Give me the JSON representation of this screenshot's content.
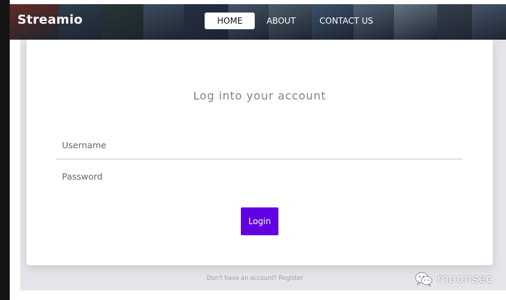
{
  "header": {
    "brand": "Streamio",
    "nav": [
      {
        "label": "HOME",
        "active": true
      },
      {
        "label": "ABOUT",
        "active": false
      },
      {
        "label": "CONTACT US",
        "active": false
      }
    ],
    "poster_colors": [
      "#8c2d20",
      "#3a4a5e",
      "#2d3f36",
      "#506178",
      "#2b3650",
      "#5c6e86",
      "#6b7a8c",
      "#4e6a92",
      "#70819a",
      "#8e9db2",
      "#44505e",
      "#5d6f8a"
    ]
  },
  "login": {
    "title": "Log into your account",
    "username_placeholder": "Username",
    "password_placeholder": "Password",
    "button_label": "Login",
    "accent_color": "#6100e3"
  },
  "footer": {
    "register_text": "Don't have an account? Register"
  },
  "watermark": {
    "text": "moonsec",
    "icon": "wechat-icon"
  }
}
